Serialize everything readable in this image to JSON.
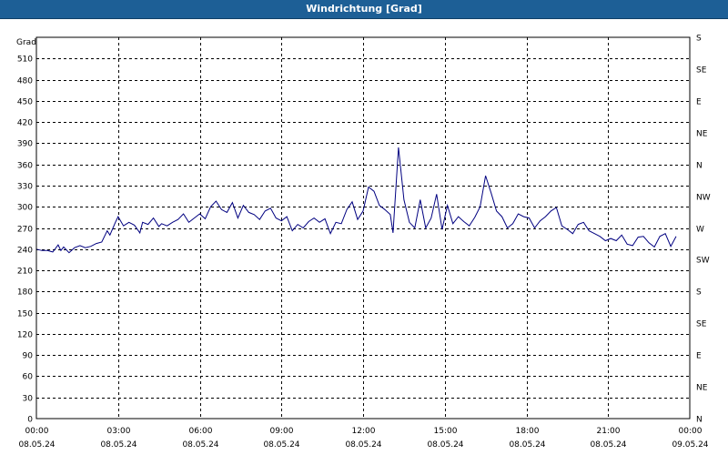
{
  "window": {
    "title": "Windrichtung [Grad]"
  },
  "chart_data": {
    "type": "line",
    "title": "Windrichtung [Grad]",
    "ylabel": "Grad",
    "xlabel": "",
    "ylim": [
      0,
      540
    ],
    "y_ticks": [
      0,
      30,
      60,
      90,
      120,
      150,
      180,
      210,
      240,
      270,
      300,
      330,
      360,
      390,
      420,
      450,
      480,
      510
    ],
    "right_ticks": [
      {
        "value": 0,
        "label": "N"
      },
      {
        "value": 45,
        "label": "NE"
      },
      {
        "value": 90,
        "label": "E"
      },
      {
        "value": 135,
        "label": "SE"
      },
      {
        "value": 180,
        "label": "S"
      },
      {
        "value": 225,
        "label": "SW"
      },
      {
        "value": 270,
        "label": "W"
      },
      {
        "value": 315,
        "label": "NW"
      },
      {
        "value": 360,
        "label": "N"
      },
      {
        "value": 405,
        "label": "NE"
      },
      {
        "value": 450,
        "label": "E"
      },
      {
        "value": 495,
        "label": "SE"
      },
      {
        "value": 540,
        "label": "S"
      }
    ],
    "x_unit": "hours since 08.05.24 00:00",
    "xlim": [
      0,
      24
    ],
    "x_ticks": [
      {
        "value": 0,
        "time": "00:00",
        "date": "08.05.24"
      },
      {
        "value": 3,
        "time": "03:00",
        "date": "08.05.24"
      },
      {
        "value": 6,
        "time": "06:00",
        "date": "08.05.24"
      },
      {
        "value": 9,
        "time": "09:00",
        "date": "08.05.24"
      },
      {
        "value": 12,
        "time": "12:00",
        "date": "08.05.24"
      },
      {
        "value": 15,
        "time": "15:00",
        "date": "08.05.24"
      },
      {
        "value": 18,
        "time": "18:00",
        "date": "08.05.24"
      },
      {
        "value": 21,
        "time": "21:00",
        "date": "08.05.24"
      },
      {
        "value": 24,
        "time": "00:00",
        "date": "09.05.24"
      }
    ],
    "grid": true,
    "series": [
      {
        "color": "#000080",
        "x": [
          0.0,
          0.2,
          0.4,
          0.6,
          0.8,
          0.9,
          1.0,
          1.2,
          1.4,
          1.6,
          1.8,
          2.0,
          2.2,
          2.4,
          2.6,
          2.7,
          2.9,
          3.0,
          3.2,
          3.4,
          3.6,
          3.8,
          3.9,
          4.1,
          4.3,
          4.5,
          4.6,
          4.8,
          5.0,
          5.2,
          5.4,
          5.6,
          5.8,
          6.0,
          6.2,
          6.4,
          6.6,
          6.8,
          7.0,
          7.2,
          7.4,
          7.6,
          7.8,
          8.0,
          8.2,
          8.4,
          8.6,
          8.8,
          9.0,
          9.2,
          9.4,
          9.6,
          9.8,
          10.0,
          10.2,
          10.4,
          10.6,
          10.8,
          11.0,
          11.2,
          11.4,
          11.6,
          11.8,
          12.0,
          12.2,
          12.4,
          12.6,
          12.8,
          13.0,
          13.1,
          13.3,
          13.5,
          13.7,
          13.9,
          14.1,
          14.3,
          14.5,
          14.7,
          14.9,
          15.1,
          15.3,
          15.5,
          15.7,
          15.9,
          16.1,
          16.3,
          16.5,
          16.7,
          16.9,
          17.1,
          17.3,
          17.5,
          17.7,
          17.9,
          18.1,
          18.3,
          18.5,
          18.7,
          18.9,
          19.1,
          19.3,
          19.5,
          19.7,
          19.9,
          20.1,
          20.3,
          20.5,
          20.7,
          20.9,
          21.1,
          21.3,
          21.5,
          21.7,
          21.9,
          22.1,
          22.3,
          22.5,
          22.7,
          22.9,
          23.1,
          23.3,
          23.5
        ],
        "y": [
          240,
          238,
          238,
          236,
          246,
          238,
          243,
          235,
          242,
          245,
          242,
          244,
          248,
          250,
          266,
          260,
          278,
          286,
          273,
          278,
          274,
          263,
          278,
          275,
          284,
          272,
          276,
          273,
          278,
          282,
          290,
          278,
          284,
          290,
          283,
          300,
          308,
          296,
          292,
          306,
          284,
          302,
          292,
          289,
          282,
          294,
          298,
          284,
          280,
          286,
          266,
          275,
          270,
          279,
          284,
          278,
          283,
          262,
          278,
          276,
          296,
          307,
          282,
          294,
          328,
          322,
          302,
          296,
          289,
          263,
          384,
          310,
          278,
          270,
          310,
          270,
          284,
          318,
          268,
          302,
          276,
          286,
          279,
          273,
          285,
          300,
          344,
          320,
          294,
          286,
          270,
          276,
          290,
          286,
          284,
          270,
          280,
          286,
          294,
          299,
          273,
          268,
          262,
          275,
          278,
          266,
          262,
          258,
          252,
          255,
          252,
          260,
          247,
          245,
          257,
          258,
          249,
          243,
          258,
          262,
          244,
          258
        ]
      }
    ]
  }
}
